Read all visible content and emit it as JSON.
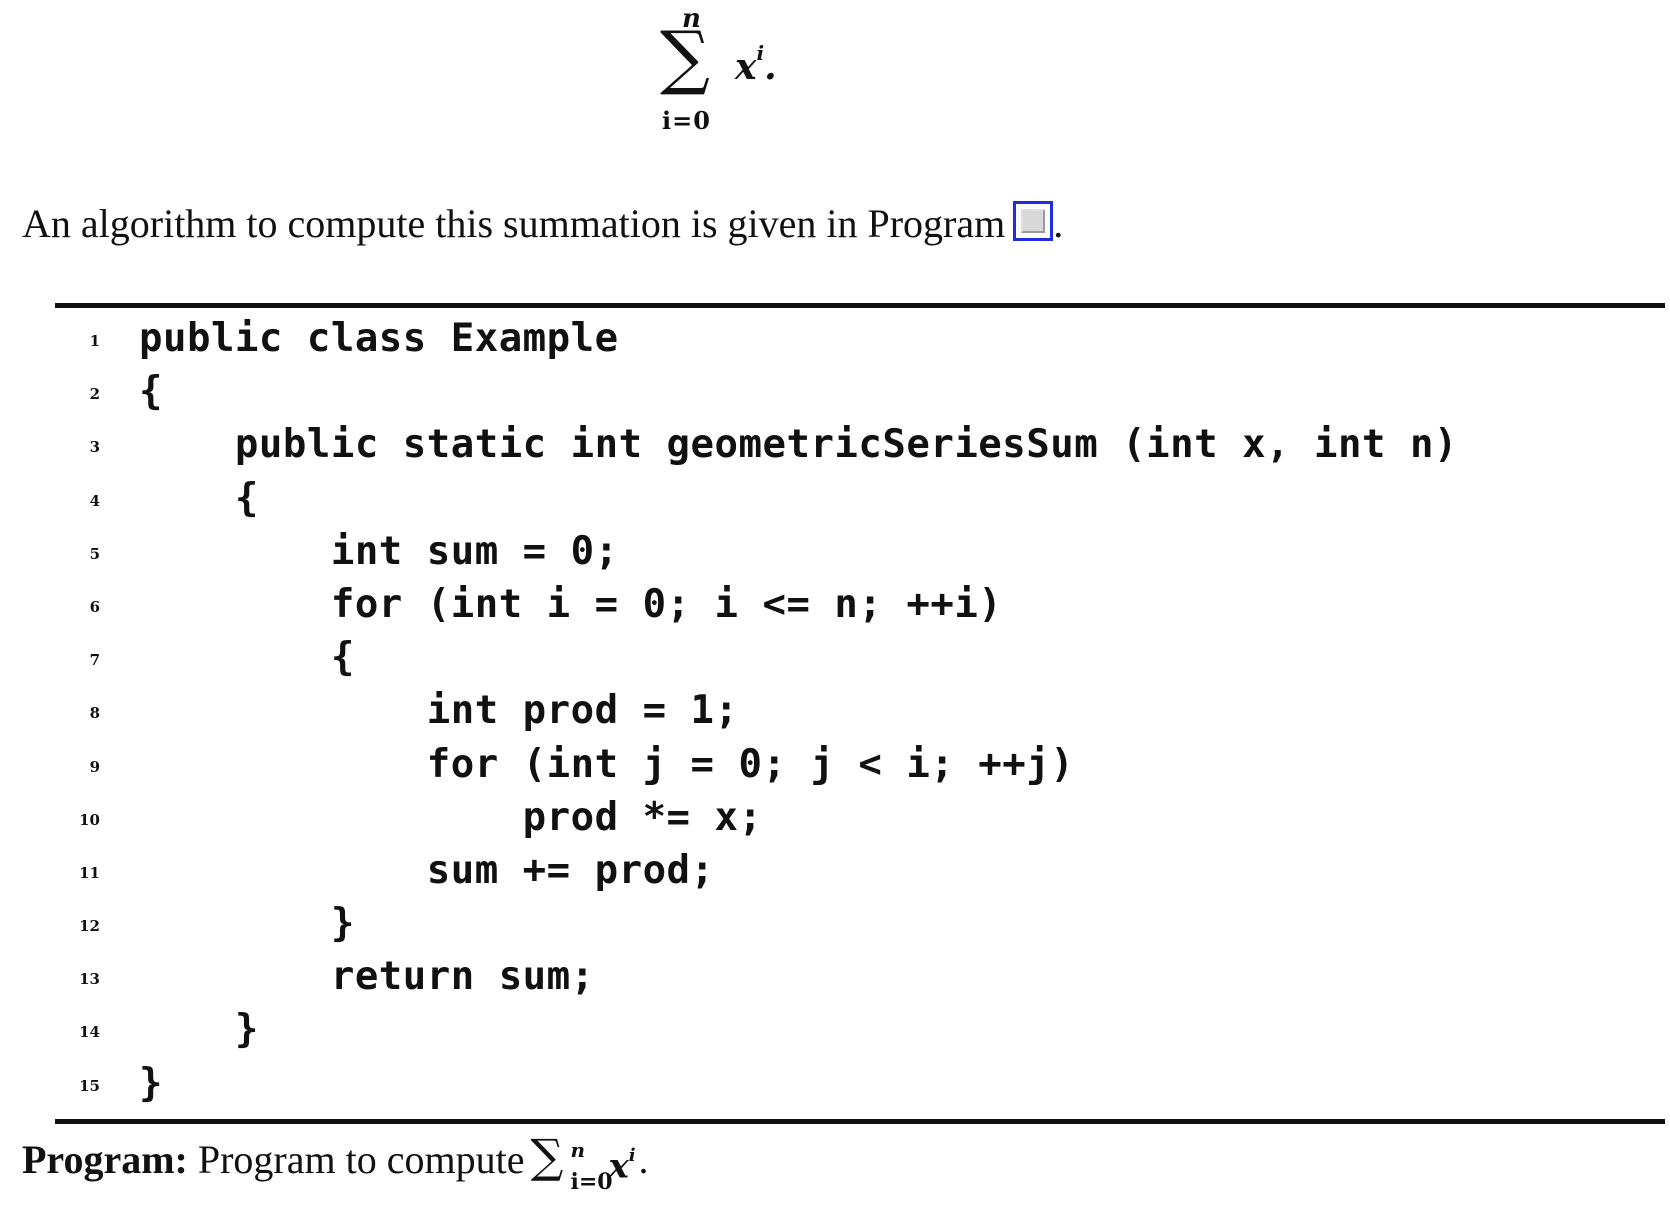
{
  "equation": {
    "sigma": "∑",
    "upper_limit": "n",
    "lower_limit": "i=0",
    "base": "x",
    "exponent": "i",
    "trailing": "."
  },
  "intro": {
    "text": "An algorithm to compute this summation is given in Program",
    "trailing": "."
  },
  "program": {
    "lines": [
      {
        "number": "1",
        "code": "public class Example"
      },
      {
        "number": "2",
        "code": "{"
      },
      {
        "number": "3",
        "code": "    public static int geometricSeriesSum (int x, int n)"
      },
      {
        "number": "4",
        "code": "    {"
      },
      {
        "number": "5",
        "code": "        int sum = 0;"
      },
      {
        "number": "6",
        "code": "        for (int i = 0; i <= n; ++i)"
      },
      {
        "number": "7",
        "code": "        {"
      },
      {
        "number": "8",
        "code": "            int prod = 1;"
      },
      {
        "number": "9",
        "code": "            for (int j = 0; j < i; ++j)"
      },
      {
        "number": "10",
        "code": "                prod *= x;"
      },
      {
        "number": "11",
        "code": "            sum += prod;"
      },
      {
        "number": "12",
        "code": "        }"
      },
      {
        "number": "13",
        "code": "        return sum;"
      },
      {
        "number": "14",
        "code": "    }"
      },
      {
        "number": "15",
        "code": "}"
      }
    ]
  },
  "caption": {
    "label": "Program:",
    "text": "Program to compute",
    "sigma": "∑",
    "upper_limit": "n",
    "lower_limit": "i=0",
    "base": "x",
    "exponent": "i",
    "trailing": "."
  }
}
